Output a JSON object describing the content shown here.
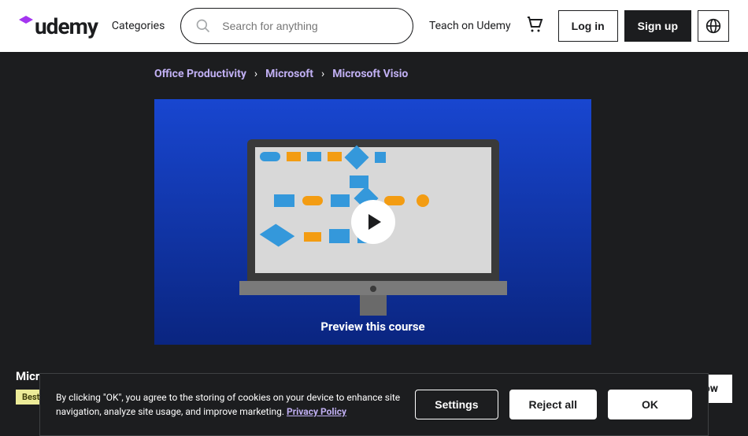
{
  "header": {
    "categories": "Categories",
    "searchPlaceholder": "Search for anything",
    "teach": "Teach on Udemy",
    "login": "Log in",
    "signup": "Sign up"
  },
  "breadcrumb": {
    "a": "Office Productivity",
    "b": "Microsoft",
    "c": "Microsoft Visio"
  },
  "preview": {
    "label": "Preview this course"
  },
  "course": {
    "titlePrefix": "Micr",
    "badge": "Best",
    "buySuffix": "ow"
  },
  "cookie": {
    "text": "By clicking \"OK\", you agree to the storing of cookies on your device to enhance site navigation, analyze site usage, and improve marketing. ",
    "policy": "Privacy Policy",
    "settings": "Settings",
    "reject": "Reject all",
    "ok": "OK"
  }
}
